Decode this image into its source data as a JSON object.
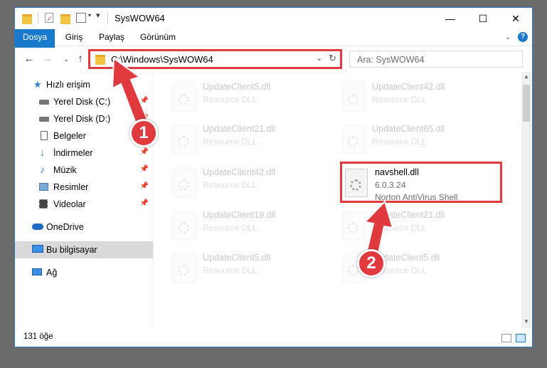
{
  "window": {
    "title": "SysWOW64"
  },
  "window_controls": {
    "minimize": "—",
    "maximize": "☐",
    "close": "✕"
  },
  "ribbon": {
    "tabs": [
      "Dosya",
      "Giriş",
      "Paylaş",
      "Görünüm"
    ]
  },
  "address": {
    "path": "C:\\Windows\\SysWOW64"
  },
  "search": {
    "placeholder": "Ara: SysWOW64"
  },
  "sidebar": {
    "items": [
      {
        "label": "Hızlı erişim",
        "icon": "star-icon",
        "pinned": false
      },
      {
        "label": "Yerel Disk (C:)",
        "icon": "drive-icon",
        "pinned": true
      },
      {
        "label": "Yerel Disk (D:)",
        "icon": "drive-icon",
        "pinned": true
      },
      {
        "label": "Belgeler",
        "icon": "documents-icon",
        "pinned": true
      },
      {
        "label": "İndirmeler",
        "icon": "download-icon",
        "pinned": true
      },
      {
        "label": "Müzik",
        "icon": "music-icon",
        "pinned": true
      },
      {
        "label": "Resimler",
        "icon": "pictures-icon",
        "pinned": true
      },
      {
        "label": "Videolar",
        "icon": "videos-icon",
        "pinned": true
      },
      {
        "label": "OneDrive",
        "icon": "cloud-icon",
        "pinned": false
      },
      {
        "label": "Bu bilgisayar",
        "icon": "computer-icon",
        "pinned": false
      },
      {
        "label": "Ağ",
        "icon": "network-icon",
        "pinned": false
      }
    ]
  },
  "files": [
    {
      "name": "UpdateClient5.dll",
      "desc": "Resource DLL"
    },
    {
      "name": "UpdateClient42.dll",
      "desc": "Resource DLL"
    },
    {
      "name": "UpdateClient21.dll",
      "desc": "Resource DLL"
    },
    {
      "name": "UpdateClient65.dll",
      "desc": "Resource DLL"
    },
    {
      "name": "UpdateClient42.dll",
      "desc": "Resource DLL"
    },
    {
      "name": "navshell.dll",
      "desc": "6.0.3.24",
      "desc2": "Norton AntiVirus Shell"
    },
    {
      "name": "UpdateClient19.dll",
      "desc": "Resource DLL"
    },
    {
      "name": "UpdateClient21.dll",
      "desc": "Resource DLL"
    },
    {
      "name": "UpdateClient5.dll",
      "desc": "Resource DLL"
    },
    {
      "name": "UpdateClient5.dll",
      "desc": "Resource DLL"
    }
  ],
  "status": {
    "count": "131 öğe"
  },
  "annotations": {
    "step1": "1",
    "step2": "2",
    "color": "#e0393e"
  }
}
